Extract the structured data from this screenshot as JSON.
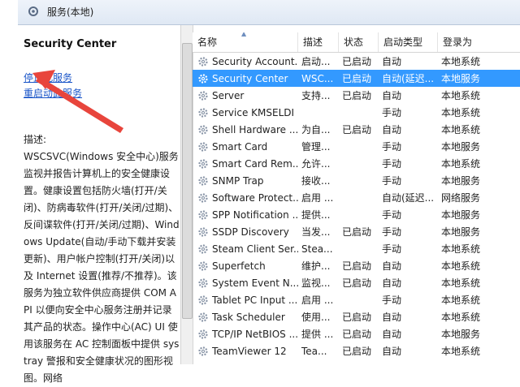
{
  "header": {
    "title": "服务(本地)"
  },
  "left_panel": {
    "service_title": "Security Center",
    "stop_link": "停止此服务",
    "restart_link": "重启动此服务",
    "desc_label": "描述:",
    "description": "WSCSVC(Windows 安全中心)服务监视并报告计算机上的安全健康设置。健康设置包括防火墙(打开/关闭)、防病毒软件(打开/关闭/过期)、反间谍软件(打开/关闭/过期)、Windows Update(自动/手动下载并安装更新)、用户帐户控制(打开/关闭)以及 Internet 设置(推荐/不推荐)。该服务为独立软件供应商提供 COM API 以便向安全中心服务注册并记录其产品的状态。操作中心(AC) UI 使用该服务在 AC 控制面板中提供 systray 警报和安全健康状况的图形视图。网络"
  },
  "columns": {
    "name": "名称",
    "desc": "描述",
    "status": "状态",
    "startup": "启动类型",
    "logon": "登录为"
  },
  "services": [
    {
      "name": "Security Account...",
      "desc": "启动...",
      "status": "已启动",
      "startup": "自动",
      "logon": "本地系统"
    },
    {
      "name": "Security Center",
      "desc": "WSC...",
      "status": "已启动",
      "startup": "自动(延迟...",
      "logon": "本地服务"
    },
    {
      "name": "Server",
      "desc": "支持...",
      "status": "已启动",
      "startup": "自动",
      "logon": "本地系统"
    },
    {
      "name": "Service KMSELDI",
      "desc": "",
      "status": "",
      "startup": "手动",
      "logon": "本地系统"
    },
    {
      "name": "Shell Hardware ...",
      "desc": "为自...",
      "status": "已启动",
      "startup": "自动",
      "logon": "本地系统"
    },
    {
      "name": "Smart Card",
      "desc": "管理...",
      "status": "",
      "startup": "手动",
      "logon": "本地服务"
    },
    {
      "name": "Smart Card Rem...",
      "desc": "允许...",
      "status": "",
      "startup": "手动",
      "logon": "本地系统"
    },
    {
      "name": "SNMP Trap",
      "desc": "接收...",
      "status": "",
      "startup": "手动",
      "logon": "本地服务"
    },
    {
      "name": "Software Protect...",
      "desc": "启用 ...",
      "status": "",
      "startup": "自动(延迟...",
      "logon": "网络服务"
    },
    {
      "name": "SPP Notification ...",
      "desc": "提供...",
      "status": "",
      "startup": "手动",
      "logon": "本地服务"
    },
    {
      "name": "SSDP Discovery",
      "desc": "当发...",
      "status": "已启动",
      "startup": "手动",
      "logon": "本地服务"
    },
    {
      "name": "Steam Client Ser...",
      "desc": "Stea...",
      "status": "",
      "startup": "手动",
      "logon": "本地系统"
    },
    {
      "name": "Superfetch",
      "desc": "维护...",
      "status": "已启动",
      "startup": "自动",
      "logon": "本地系统"
    },
    {
      "name": "System Event N...",
      "desc": "监视...",
      "status": "已启动",
      "startup": "自动",
      "logon": "本地系统"
    },
    {
      "name": "Tablet PC Input ...",
      "desc": "启用 ...",
      "status": "",
      "startup": "手动",
      "logon": "本地系统"
    },
    {
      "name": "Task Scheduler",
      "desc": "使用...",
      "status": "已启动",
      "startup": "自动",
      "logon": "本地系统"
    },
    {
      "name": "TCP/IP NetBIOS ...",
      "desc": "提供 ...",
      "status": "已启动",
      "startup": "自动",
      "logon": "本地服务"
    },
    {
      "name": "TeamViewer 12",
      "desc": "Tea...",
      "status": "已启动",
      "startup": "自动",
      "logon": "本地系统"
    }
  ],
  "selected_index": 1,
  "colors": {
    "selection": "#3399ff",
    "link": "#1a55c8",
    "arrow": "#e8453c"
  }
}
